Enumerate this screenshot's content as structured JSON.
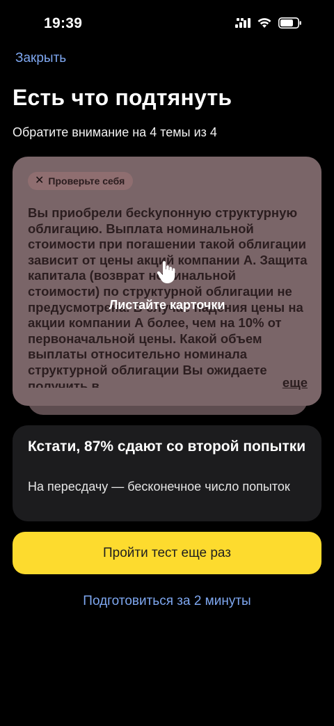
{
  "status_bar": {
    "time": "19:39"
  },
  "header": {
    "close_label": "Закрыть",
    "title": "Есть что подтянуть",
    "subtitle": "Обратите внимание на 4 темы из 4"
  },
  "question_card": {
    "chip_label": "Проверьте себя",
    "text": "Вы приобрели бесkупонную структурную облигацию. Выплата номинальной стоимости при погашении такой облигации зависит от цены акций компании А. Защита капитала (возврат номинальной стоимости) по структурной облигации не предусмотрена. В случае падения цены на акции компании А более, чем на 10% от первоначальной цены. Какой объем выплаты относительно номинала структурной облигации Вы ожидаете получить в",
    "more_label": "еще",
    "swipe_hint": "Листайте карточки"
  },
  "info_card": {
    "title": "Кстати, 87% сдают со второй попытки",
    "text": "На пересдачу — бесконечное число попыток"
  },
  "actions": {
    "retry_label": "Пройти тест еще раз",
    "prepare_label": "Подготовиться за 2 минуты"
  },
  "colors": {
    "accent_link": "#7ea7f0",
    "primary_button": "#fddb2e",
    "card": "#7a6568",
    "info_card": "#1c1c1e"
  }
}
